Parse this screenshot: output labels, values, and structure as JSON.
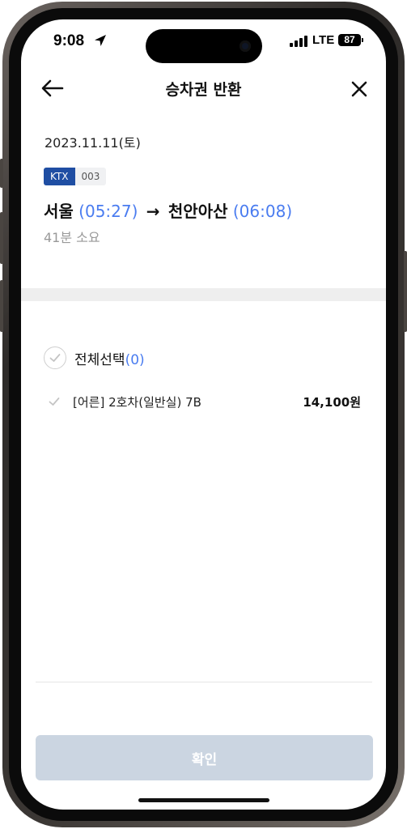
{
  "status_bar": {
    "time": "9:08",
    "network": "LTE",
    "battery": "87"
  },
  "header": {
    "title": "승차권 반환"
  },
  "trip": {
    "date": "2023.11.11(토)",
    "train_type": "KTX",
    "train_number": "003",
    "departure_station": "서울",
    "departure_time": "(05:27)",
    "arrow": "→",
    "arrival_station": "천안아산",
    "arrival_time": "(06:08)",
    "duration": "41분 소요"
  },
  "selection": {
    "select_all_label": "전체선택",
    "select_all_count": "(0)"
  },
  "tickets": [
    {
      "description": "[어른] 2호차(일반실) 7B",
      "price": "14,100원"
    }
  ],
  "footer": {
    "confirm_label": "확인"
  },
  "colors": {
    "accent": "#4a7cf0",
    "ktx_badge": "#1f4ea3",
    "button_disabled": "#cbd5e1",
    "divider": "#eeeeee"
  }
}
